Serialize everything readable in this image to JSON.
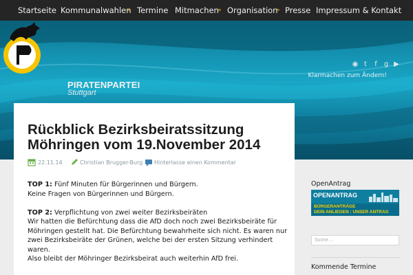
{
  "nav": {
    "items": [
      "Startseite",
      "Kommunalwahlen",
      "Termine",
      "Mitmachen",
      "Organisation",
      "Presse",
      "Impressum & Kontakt"
    ]
  },
  "header": {
    "logo_title": "PIRATENPARTEI",
    "logo_sub": "Stuttgart",
    "social_icons": [
      "rss-icon",
      "twitter-icon",
      "facebook-icon",
      "googleplus-icon",
      "youtube-icon"
    ],
    "tagline": "Klarmachen zum Ändern!"
  },
  "post": {
    "title": "Rückblick Bezirksbeiratssitzung Möhringen vom 19.November 2014",
    "date": "22.11.14",
    "author": "Christian Brugger-Burg",
    "comment_link": "Hinterlasse einen Kommentar",
    "top1_label": "TOP 1:",
    "top1_text": "Fünf Minuten für Bürgerinnen und Bürgern.",
    "top1_line2": "Keine Fragen von Bürgerinnen und Bürgern.",
    "top2_label": "TOP 2:",
    "top2_text": "Verpflichtung von zwei weiter Bezirksbeiräten",
    "top2_para": "Wir hatten die Befürchtung dass die AfD doch noch zwei Bezirksbeiräte für Möhringen gestellt hat. Die Befürchtung bewahrheite sich nicht. Es waren nur zwei Bezirksbeiräte der Grünen, welche bei der ersten Sitzung verhindert waren.",
    "top2_last": "Also bleibt der Möhringer Bezirksbeirat auch weiterhin AfD frei."
  },
  "sidebar": {
    "openantrag_heading": "OpenAntrag",
    "openantrag_logo": "OPENANTRAG",
    "openantrag_line1": "BÜRGERANTRÄGE",
    "openantrag_line2": "DEIN ANLIEGEN : UNSER ANTRAG",
    "search_placeholder": "Suche ...",
    "termine_heading": "Kommende Termine"
  },
  "colors": {
    "nav_bg": "#252525",
    "accent": "#e8b700",
    "header_blue": "#148fae",
    "meta_text": "#8a9aa1",
    "icon_green": "#6bb04a",
    "icon_blue": "#3f7fb3"
  }
}
